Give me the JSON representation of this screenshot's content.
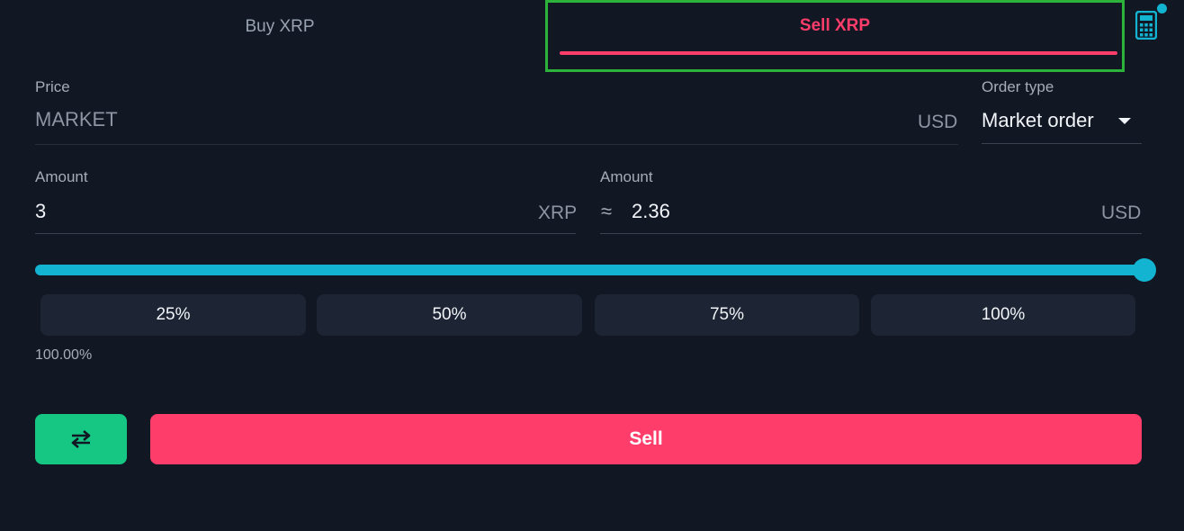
{
  "tabs": {
    "buy_label": "Buy XRP",
    "sell_label": "Sell XRP"
  },
  "price": {
    "label": "Price",
    "value": "MARKET",
    "unit": "USD"
  },
  "order_type": {
    "label": "Order type",
    "value": "Market order"
  },
  "amount_base": {
    "label": "Amount",
    "value": "3",
    "unit": "XRP"
  },
  "amount_quote": {
    "label": "Amount",
    "approx_symbol": "≈",
    "value": "2.36",
    "unit": "USD"
  },
  "slider": {
    "percent": 100
  },
  "percent_buttons": [
    "25%",
    "50%",
    "75%",
    "100%"
  ],
  "percent_display": "100.00%",
  "actions": {
    "swap_icon": "swap-arrows-icon",
    "sell_label": "Sell"
  },
  "colors": {
    "background": "#111723",
    "sell_accent": "#ff3d6b",
    "slider": "#12b4d1",
    "swap_button": "#16c784",
    "highlight_box": "#2db33a"
  },
  "icons": {
    "calculator": "calculator-icon",
    "notification_dot": "notification-dot"
  }
}
